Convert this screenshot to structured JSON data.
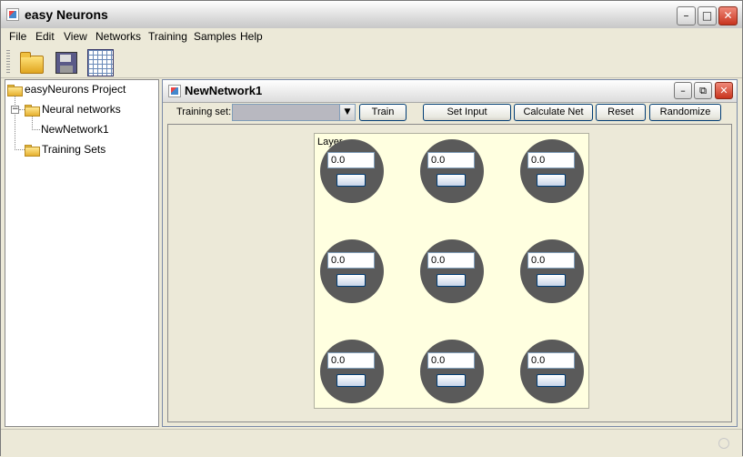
{
  "app": {
    "title": "easy Neurons"
  },
  "menu": [
    "File",
    "Edit",
    "View",
    "Networks",
    "Training",
    "Samples",
    "Help"
  ],
  "toolbar": {
    "icons": [
      "open-folder-icon",
      "save-disk-icon",
      "table-grid-icon"
    ]
  },
  "tree": {
    "root": "easyNeurons Project",
    "neural_networks": "Neural networks",
    "network_item": "NewNetwork1",
    "training_sets": "Training Sets"
  },
  "network_window": {
    "title": "NewNetwork1",
    "training_set_label": "Training set:",
    "training_set_value": "",
    "buttons": {
      "train": "Train",
      "set_input": "Set Input",
      "calculate_net": "Calculate Net",
      "reset": "Reset",
      "randomize": "Randomize"
    },
    "layer_label": "Layer",
    "neurons": [
      "0.0",
      "0.0",
      "0.0",
      "0.0",
      "0.0",
      "0.0",
      "0.0",
      "0.0",
      "0.0"
    ]
  },
  "colors": {
    "neuron_fill": "#5a5a5a",
    "layer_background": "#ffffe0",
    "window_background": "#ece9d8",
    "close_button": "#c8341e"
  }
}
